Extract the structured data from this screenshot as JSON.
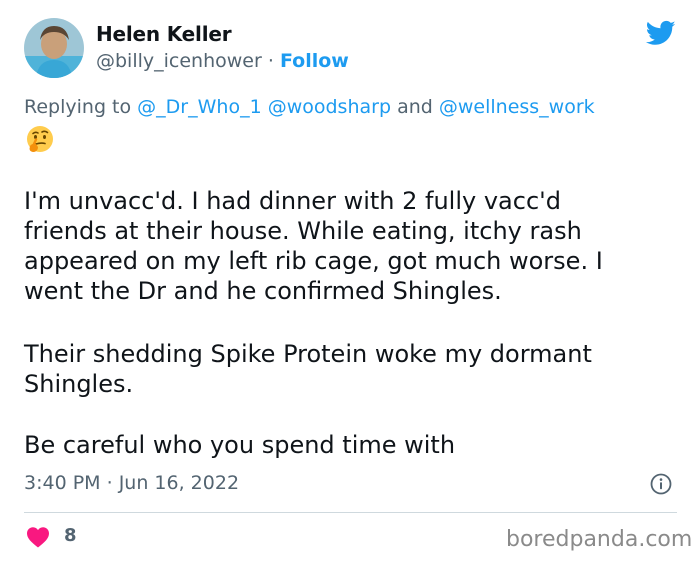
{
  "author": {
    "name": "Helen Keller",
    "handle": "@billy_icenhower",
    "separator": "·",
    "follow_label": "Follow"
  },
  "reply": {
    "prefix": "Replying to",
    "mention_1": "@_Dr_Who_1",
    "mention_2": "@woodsharp",
    "conjunction": "and",
    "mention_3": "@wellness_work"
  },
  "tweet": {
    "emoji_icon": "thinking-face-emoji",
    "p1_lines": [
      "I'm unvacc'd.  I had dinner with 2 fully vacc'd",
      "friends at their house. While eating, itchy rash",
      "appeared on my left rib cage, got much worse. I",
      "went the Dr and he confirmed Shingles."
    ],
    "p2_lines": [
      "Their shedding Spike Protein woke my dormant",
      "Shingles."
    ],
    "p3_lines": [
      "Be careful who you spend time with"
    ],
    "time": "3:40 PM",
    "date": "Jun 16, 2022"
  },
  "engagement": {
    "like_count": "8"
  },
  "watermark": "boredpanda.com",
  "colors": {
    "accent": "#1d9bf0",
    "heart": "#f91880",
    "secondary_text": "#536471",
    "primary_text": "#0f1419"
  },
  "icons": {
    "brand": "twitter-bird-icon",
    "info": "info-icon",
    "like": "heart-icon"
  }
}
